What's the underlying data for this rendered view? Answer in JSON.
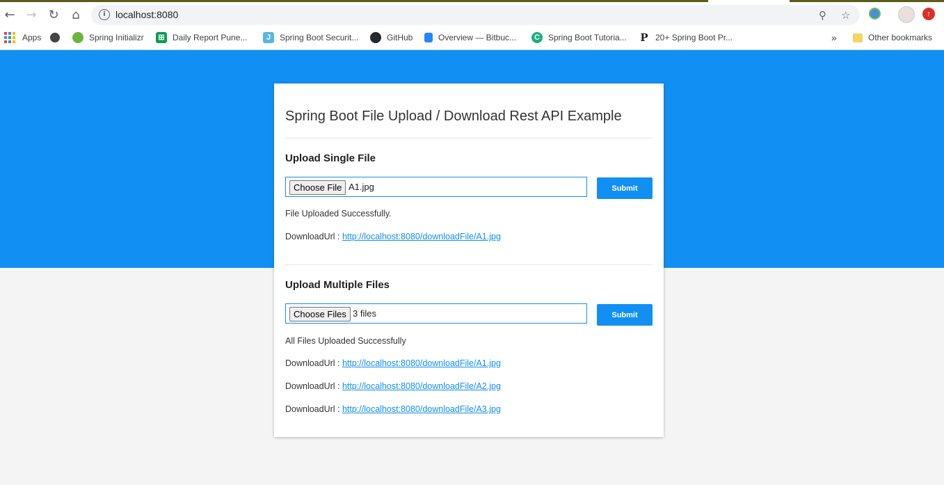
{
  "browser": {
    "url": "localhost:8080",
    "bookmarks": [
      {
        "label": "Apps",
        "icon": "apps-grid-icon"
      },
      {
        "label": "",
        "icon": "globe-icon"
      },
      {
        "label": "Spring Initializr",
        "icon": "spring-icon"
      },
      {
        "label": "Daily Report Pune...",
        "icon": "sheets-icon"
      },
      {
        "label": "Spring Boot Securit...",
        "icon": "j-icon"
      },
      {
        "label": "GitHub",
        "icon": "github-icon"
      },
      {
        "label": "Overview — Bitbuc...",
        "icon": "bitbucket-icon"
      },
      {
        "label": "Spring Boot Tutoria...",
        "icon": "c-icon"
      },
      {
        "label": "20+ Spring Boot Pr...",
        "icon": "p-icon"
      }
    ],
    "overflow": "»",
    "other_bookmarks": "Other bookmarks"
  },
  "page": {
    "title": "Spring Boot File Upload / Download Rest API Example",
    "single": {
      "heading": "Upload Single File",
      "choose_label": "Choose File",
      "file_name": "A1.jpg",
      "submit_label": "Submit",
      "message": "File Uploaded Successfully.",
      "downloads": [
        {
          "label": "DownloadUrl : ",
          "url": "http://localhost:8080/downloadFile/A1.jpg"
        }
      ]
    },
    "multiple": {
      "heading": "Upload Multiple Files",
      "choose_label": "Choose Files",
      "file_name": "3 files",
      "submit_label": "Submit",
      "message": "All Files Uploaded Successfully",
      "downloads": [
        {
          "label": "DownloadUrl : ",
          "url": "http://localhost:8080/downloadFile/A1.jpg"
        },
        {
          "label": "DownloadUrl : ",
          "url": "http://localhost:8080/downloadFile/A2.jpg"
        },
        {
          "label": "DownloadUrl : ",
          "url": "http://localhost:8080/downloadFile/A3.jpg"
        }
      ]
    }
  },
  "colors": {
    "primary": "#128ff2",
    "background": "#f4f4f4"
  }
}
